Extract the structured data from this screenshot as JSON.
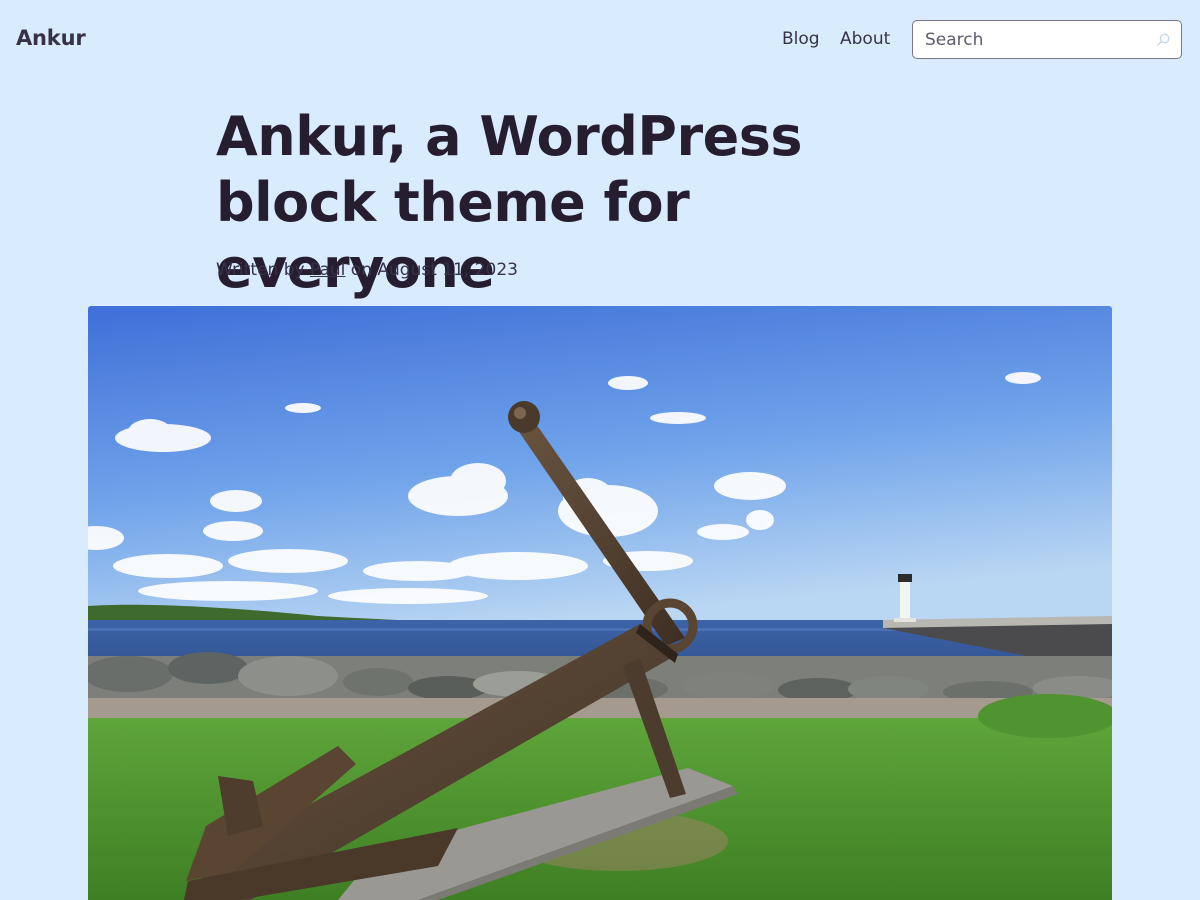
{
  "site": {
    "title": "Ankur"
  },
  "nav": {
    "items": [
      {
        "label": "Blog"
      },
      {
        "label": "About"
      }
    ]
  },
  "search": {
    "placeholder": "Search",
    "value": ""
  },
  "post": {
    "title": "Ankur, a WordPress block theme for everyone",
    "byline_prefix": "Written by",
    "author": "Paul",
    "byline_middle": "on",
    "date": "August 11, 2023"
  },
  "colors": {
    "background": "#d9ecfd",
    "text": "#261d31"
  },
  "icons": {
    "search": "search-icon"
  }
}
